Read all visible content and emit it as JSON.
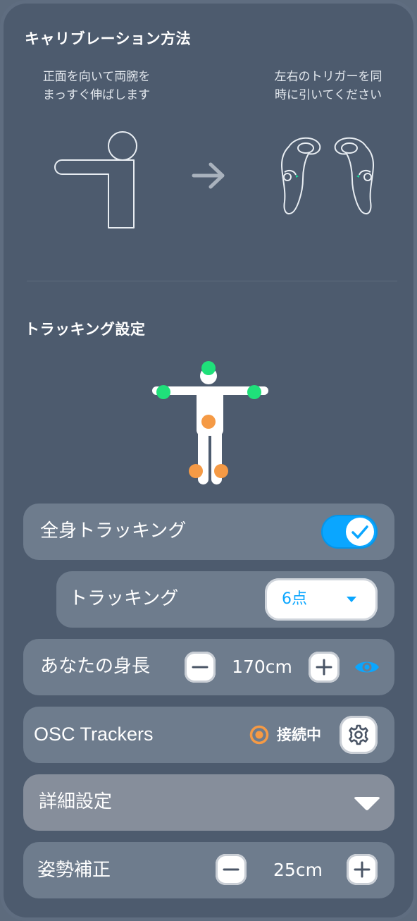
{
  "calibration": {
    "heading": "キャリブレーション方法",
    "step1_line1": "正面を向いて両腕を",
    "step1_line2": "まっすぐ伸ばします",
    "step2_line1": "左右のトリガーを同",
    "step2_line2": "時に引いてください"
  },
  "tracking": {
    "heading": "トラッキング設定",
    "full_body": {
      "label": "全身トラッキング",
      "enabled": true
    },
    "points": {
      "label": "トラッキング",
      "selected": "6点"
    },
    "height": {
      "label": "あなたの身長",
      "value": "170cm"
    },
    "osc": {
      "label": "OSC Trackers",
      "status": "接続中"
    },
    "advanced": {
      "label": "詳細設定"
    },
    "posture": {
      "label": "姿勢補正",
      "value": "25cm"
    }
  },
  "colors": {
    "accent": "#0aa6ff",
    "tracker_green": "#1fe07a",
    "tracker_orange": "#f59a45",
    "background": "#4d5b6e"
  }
}
